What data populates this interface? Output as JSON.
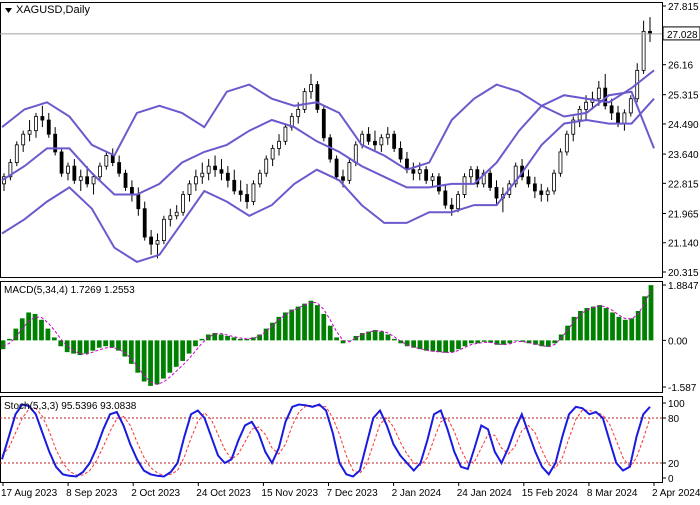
{
  "chart_data": [
    {
      "type": "candlestick",
      "title": "XAGUSD,Daily",
      "ylim": [
        20.315,
        27.815
      ],
      "price_ticks": [
        27.815,
        26.16,
        25.315,
        24.49,
        23.64,
        22.815,
        21.965,
        21.14,
        20.315
      ],
      "price_tick_labels": [
        "27.815",
        "26.16",
        "25.315",
        "24.490",
        "23.640",
        "22.815",
        "21.965",
        "21.140",
        "20.315"
      ],
      "current_price": 27.028,
      "current_price_label": "27.028",
      "x_labels": [
        "17 Aug 2023",
        "8 Sep 2023",
        "2 Oct 2023",
        "24 Oct 2023",
        "15 Nov 2023",
        "7 Dec 2023",
        "2 Jan 2024",
        "24 Jan 2024",
        "15 Feb 2024",
        "8 Mar 2024",
        "2 Apr 2024"
      ],
      "ohlc": [
        [
          22.8,
          23.1,
          22.6,
          23.0
        ],
        [
          23.0,
          23.5,
          22.9,
          23.4
        ],
        [
          23.4,
          24.0,
          23.3,
          23.9
        ],
        [
          23.9,
          24.3,
          23.7,
          24.2
        ],
        [
          24.2,
          24.6,
          24.0,
          24.3
        ],
        [
          24.3,
          24.8,
          24.1,
          24.7
        ],
        [
          24.7,
          25.0,
          24.4,
          24.6
        ],
        [
          24.6,
          24.8,
          24.1,
          24.2
        ],
        [
          24.2,
          24.4,
          23.6,
          23.7
        ],
        [
          23.7,
          23.8,
          23.0,
          23.1
        ],
        [
          23.1,
          23.4,
          22.9,
          23.3
        ],
        [
          23.3,
          23.5,
          22.8,
          22.9
        ],
        [
          22.9,
          23.2,
          22.6,
          23.0
        ],
        [
          23.0,
          23.3,
          22.7,
          22.8
        ],
        [
          22.8,
          23.1,
          22.5,
          23.0
        ],
        [
          23.0,
          23.4,
          22.9,
          23.3
        ],
        [
          23.3,
          23.7,
          23.2,
          23.6
        ],
        [
          23.6,
          23.8,
          23.3,
          23.4
        ],
        [
          23.4,
          23.6,
          23.0,
          23.1
        ],
        [
          23.1,
          23.2,
          22.6,
          22.7
        ],
        [
          22.7,
          22.9,
          22.3,
          22.5
        ],
        [
          22.5,
          22.7,
          21.9,
          22.1
        ],
        [
          22.1,
          22.3,
          21.2,
          21.3
        ],
        [
          21.3,
          21.5,
          20.8,
          21.1
        ],
        [
          21.1,
          21.4,
          20.7,
          21.2
        ],
        [
          21.2,
          21.9,
          21.1,
          21.8
        ],
        [
          21.8,
          22.1,
          21.6,
          21.9
        ],
        [
          21.9,
          22.2,
          21.8,
          22.0
        ],
        [
          22.0,
          22.6,
          21.9,
          22.5
        ],
        [
          22.5,
          22.9,
          22.3,
          22.8
        ],
        [
          22.8,
          23.2,
          22.6,
          23.0
        ],
        [
          23.0,
          23.4,
          22.8,
          23.1
        ],
        [
          23.1,
          23.5,
          22.9,
          23.3
        ],
        [
          23.3,
          23.6,
          23.0,
          23.2
        ],
        [
          23.2,
          23.5,
          22.9,
          23.1
        ],
        [
          23.1,
          23.3,
          22.7,
          22.9
        ],
        [
          22.9,
          23.2,
          22.5,
          22.6
        ],
        [
          22.6,
          22.9,
          22.3,
          22.5
        ],
        [
          22.5,
          22.8,
          22.1,
          22.3
        ],
        [
          22.3,
          22.9,
          22.2,
          22.8
        ],
        [
          22.8,
          23.2,
          22.7,
          23.1
        ],
        [
          23.1,
          23.6,
          23.0,
          23.5
        ],
        [
          23.5,
          23.9,
          23.3,
          23.8
        ],
        [
          23.8,
          24.2,
          23.6,
          24.0
        ],
        [
          24.0,
          24.5,
          23.9,
          24.4
        ],
        [
          24.4,
          24.8,
          24.3,
          24.7
        ],
        [
          24.7,
          25.1,
          24.5,
          24.9
        ],
        [
          24.9,
          25.5,
          24.8,
          25.4
        ],
        [
          25.4,
          25.9,
          25.2,
          25.6
        ],
        [
          25.6,
          25.7,
          24.8,
          24.9
        ],
        [
          24.9,
          25.0,
          24.0,
          24.1
        ],
        [
          24.1,
          24.2,
          23.4,
          23.5
        ],
        [
          23.5,
          23.6,
          22.9,
          23.0
        ],
        [
          23.0,
          23.2,
          22.7,
          22.9
        ],
        [
          22.9,
          23.5,
          22.8,
          23.4
        ],
        [
          23.4,
          24.0,
          23.3,
          23.9
        ],
        [
          23.9,
          24.3,
          23.8,
          24.2
        ],
        [
          24.2,
          24.4,
          23.9,
          24.0
        ],
        [
          24.0,
          24.3,
          23.7,
          23.9
        ],
        [
          23.9,
          24.2,
          23.7,
          24.1
        ],
        [
          24.1,
          24.4,
          23.9,
          24.2
        ],
        [
          24.2,
          24.3,
          23.7,
          23.8
        ],
        [
          23.8,
          24.0,
          23.4,
          23.5
        ],
        [
          23.5,
          23.7,
          23.1,
          23.2
        ],
        [
          23.2,
          23.4,
          22.9,
          23.1
        ],
        [
          23.1,
          23.4,
          22.9,
          23.2
        ],
        [
          23.2,
          23.3,
          22.8,
          22.9
        ],
        [
          22.9,
          23.1,
          22.7,
          23.0
        ],
        [
          23.0,
          23.1,
          22.5,
          22.6
        ],
        [
          22.6,
          22.8,
          22.1,
          22.2
        ],
        [
          22.2,
          22.4,
          21.9,
          22.1
        ],
        [
          22.1,
          22.6,
          22.0,
          22.5
        ],
        [
          22.5,
          23.1,
          22.4,
          23.0
        ],
        [
          23.0,
          23.3,
          22.8,
          23.2
        ],
        [
          23.2,
          23.3,
          22.7,
          22.8
        ],
        [
          22.8,
          23.2,
          22.7,
          23.1
        ],
        [
          23.1,
          23.2,
          22.6,
          22.7
        ],
        [
          22.7,
          22.9,
          22.2,
          22.4
        ],
        [
          22.4,
          22.7,
          22.0,
          22.5
        ],
        [
          22.5,
          22.9,
          22.4,
          22.8
        ],
        [
          22.8,
          23.4,
          22.7,
          23.3
        ],
        [
          23.3,
          23.5,
          22.9,
          23.0
        ],
        [
          23.0,
          23.2,
          22.7,
          22.8
        ],
        [
          22.8,
          23.0,
          22.4,
          22.6
        ],
        [
          22.6,
          22.8,
          22.3,
          22.5
        ],
        [
          22.5,
          22.7,
          22.3,
          22.6
        ],
        [
          22.6,
          23.2,
          22.5,
          23.1
        ],
        [
          23.1,
          23.8,
          23.0,
          23.7
        ],
        [
          23.7,
          24.3,
          23.6,
          24.2
        ],
        [
          24.2,
          24.7,
          24.0,
          24.6
        ],
        [
          24.6,
          25.0,
          24.4,
          24.9
        ],
        [
          24.9,
          25.3,
          24.6,
          25.1
        ],
        [
          25.1,
          25.4,
          24.9,
          25.2
        ],
        [
          25.2,
          25.7,
          25.0,
          25.5
        ],
        [
          25.5,
          25.9,
          24.9,
          25.0
        ],
        [
          25.0,
          25.2,
          24.6,
          24.8
        ],
        [
          24.8,
          25.0,
          24.4,
          24.5
        ],
        [
          24.5,
          24.9,
          24.3,
          24.8
        ],
        [
          24.8,
          25.3,
          24.7,
          25.2
        ],
        [
          25.2,
          26.2,
          25.1,
          26.0
        ],
        [
          26.0,
          27.4,
          25.9,
          27.1
        ],
        [
          27.1,
          27.5,
          26.8,
          27.03
        ]
      ],
      "bollinger": {
        "upper": [
          24.4,
          24.9,
          25.1,
          24.7,
          23.9,
          23.6,
          24.8,
          25.0,
          24.8,
          24.4,
          25.4,
          25.6,
          25.2,
          25.0,
          25.1,
          24.8,
          23.9,
          23.6,
          23.2,
          23.4,
          24.6,
          25.2,
          25.6,
          25.4,
          25.0,
          24.7,
          24.8,
          25.3,
          25.4,
          23.8
        ],
        "middle": [
          22.9,
          23.3,
          23.8,
          23.8,
          23.1,
          22.5,
          22.5,
          22.8,
          23.4,
          23.7,
          23.9,
          24.3,
          24.6,
          24.4,
          24.0,
          23.7,
          23.3,
          23.0,
          22.7,
          22.7,
          22.8,
          22.8,
          23.4,
          24.3,
          25.0,
          25.3,
          25.2,
          25.1,
          25.5,
          26.0
        ],
        "lower": [
          21.4,
          21.8,
          22.3,
          22.7,
          22.1,
          21.0,
          20.6,
          20.8,
          21.7,
          22.6,
          22.3,
          21.9,
          22.2,
          22.8,
          23.2,
          22.9,
          22.2,
          21.7,
          21.7,
          22.0,
          22.0,
          22.2,
          22.2,
          23.0,
          23.9,
          24.5,
          24.6,
          24.5,
          24.5,
          25.2
        ]
      }
    },
    {
      "type": "histogram",
      "title": "MACD(5,34,4) 1.7269 1.2553",
      "ylim": [
        -1.587,
        1.8847
      ],
      "y_ticks": [
        1.8847,
        0.0,
        -1.587
      ],
      "y_tick_labels": [
        "1.8847",
        "0.00",
        "-1.587"
      ],
      "macd_values": [
        -0.3,
        0.05,
        0.4,
        0.75,
        0.95,
        0.9,
        0.7,
        0.4,
        0.1,
        -0.2,
        -0.4,
        -0.45,
        -0.5,
        -0.45,
        -0.35,
        -0.25,
        -0.2,
        -0.25,
        -0.35,
        -0.55,
        -0.8,
        -1.1,
        -1.4,
        -1.55,
        -1.5,
        -1.3,
        -1.1,
        -0.9,
        -0.7,
        -0.45,
        -0.2,
        0.05,
        0.2,
        0.25,
        0.2,
        0.15,
        0.1,
        0.05,
        0.05,
        0.1,
        0.2,
        0.4,
        0.6,
        0.8,
        0.95,
        1.05,
        1.15,
        1.25,
        1.35,
        1.2,
        0.9,
        0.5,
        0.1,
        -0.1,
        0.0,
        0.15,
        0.25,
        0.3,
        0.35,
        0.3,
        0.2,
        0.05,
        -0.1,
        -0.2,
        -0.25,
        -0.3,
        -0.35,
        -0.38,
        -0.4,
        -0.42,
        -0.4,
        -0.3,
        -0.2,
        -0.1,
        -0.1,
        -0.05,
        -0.08,
        -0.15,
        -0.15,
        -0.1,
        0.0,
        -0.05,
        -0.1,
        -0.15,
        -0.2,
        -0.22,
        -0.1,
        0.2,
        0.5,
        0.8,
        1.0,
        1.1,
        1.15,
        1.2,
        1.1,
        0.95,
        0.8,
        0.7,
        0.75,
        1.0,
        1.5,
        1.88
      ],
      "signal_values": [
        -0.2,
        -0.1,
        0.1,
        0.4,
        0.65,
        0.8,
        0.78,
        0.6,
        0.35,
        0.05,
        -0.2,
        -0.35,
        -0.45,
        -0.47,
        -0.4,
        -0.32,
        -0.26,
        -0.24,
        -0.3,
        -0.42,
        -0.62,
        -0.9,
        -1.2,
        -1.42,
        -1.5,
        -1.42,
        -1.25,
        -1.05,
        -0.85,
        -0.62,
        -0.36,
        -0.1,
        0.1,
        0.22,
        0.23,
        0.18,
        0.12,
        0.08,
        0.05,
        0.07,
        0.15,
        0.3,
        0.5,
        0.7,
        0.87,
        1.0,
        1.1,
        1.2,
        1.3,
        1.28,
        1.05,
        0.7,
        0.3,
        0.0,
        -0.05,
        0.08,
        0.2,
        0.28,
        0.33,
        0.32,
        0.25,
        0.12,
        -0.03,
        -0.15,
        -0.23,
        -0.28,
        -0.33,
        -0.37,
        -0.39,
        -0.41,
        -0.41,
        -0.34,
        -0.24,
        -0.14,
        -0.1,
        -0.07,
        -0.07,
        -0.12,
        -0.14,
        -0.12,
        -0.04,
        -0.04,
        -0.08,
        -0.13,
        -0.18,
        -0.21,
        -0.14,
        0.08,
        0.35,
        0.65,
        0.88,
        1.03,
        1.12,
        1.18,
        1.14,
        1.02,
        0.86,
        0.74,
        0.73,
        0.9,
        1.25,
        1.73
      ]
    },
    {
      "type": "line",
      "title": "Stoch(5,3,3) 95.5396 93.0838",
      "ylim": [
        0,
        100
      ],
      "y_ticks": [
        100,
        80,
        20,
        0
      ],
      "y_tick_labels": [
        "100",
        "80",
        "20",
        "0"
      ],
      "levels": [
        80,
        20
      ],
      "series": [
        {
          "name": "%K",
          "values": [
            25,
            55,
            85,
            98,
            96,
            85,
            60,
            35,
            15,
            5,
            3,
            2,
            8,
            20,
            40,
            65,
            85,
            88,
            70,
            45,
            25,
            10,
            5,
            3,
            2,
            8,
            20,
            55,
            85,
            90,
            80,
            55,
            30,
            20,
            25,
            50,
            70,
            75,
            60,
            35,
            20,
            40,
            75,
            95,
            98,
            97,
            95,
            98,
            90,
            60,
            20,
            5,
            2,
            10,
            45,
            80,
            90,
            70,
            45,
            30,
            20,
            10,
            20,
            50,
            85,
            90,
            65,
            35,
            15,
            12,
            40,
            70,
            65,
            35,
            20,
            40,
            65,
            85,
            60,
            35,
            15,
            5,
            20,
            55,
            85,
            95,
            93,
            85,
            88,
            80,
            50,
            20,
            10,
            15,
            55,
            85,
            95
          ]
        },
        {
          "name": "%D",
          "values": [
            30,
            40,
            60,
            80,
            92,
            93,
            82,
            62,
            38,
            20,
            9,
            4,
            4,
            10,
            23,
            42,
            62,
            79,
            82,
            70,
            48,
            28,
            14,
            7,
            3,
            5,
            10,
            28,
            53,
            75,
            87,
            78,
            58,
            38,
            25,
            32,
            48,
            65,
            68,
            58,
            40,
            32,
            45,
            70,
            88,
            96,
            97,
            96,
            95,
            80,
            58,
            30,
            10,
            6,
            18,
            45,
            72,
            80,
            68,
            48,
            32,
            20,
            17,
            27,
            52,
            75,
            80,
            62,
            38,
            20,
            22,
            40,
            58,
            57,
            40,
            32,
            42,
            63,
            70,
            60,
            37,
            18,
            13,
            27,
            53,
            78,
            91,
            90,
            88,
            84,
            72,
            50,
            27,
            15,
            27,
            52,
            80
          ]
        }
      ]
    }
  ]
}
